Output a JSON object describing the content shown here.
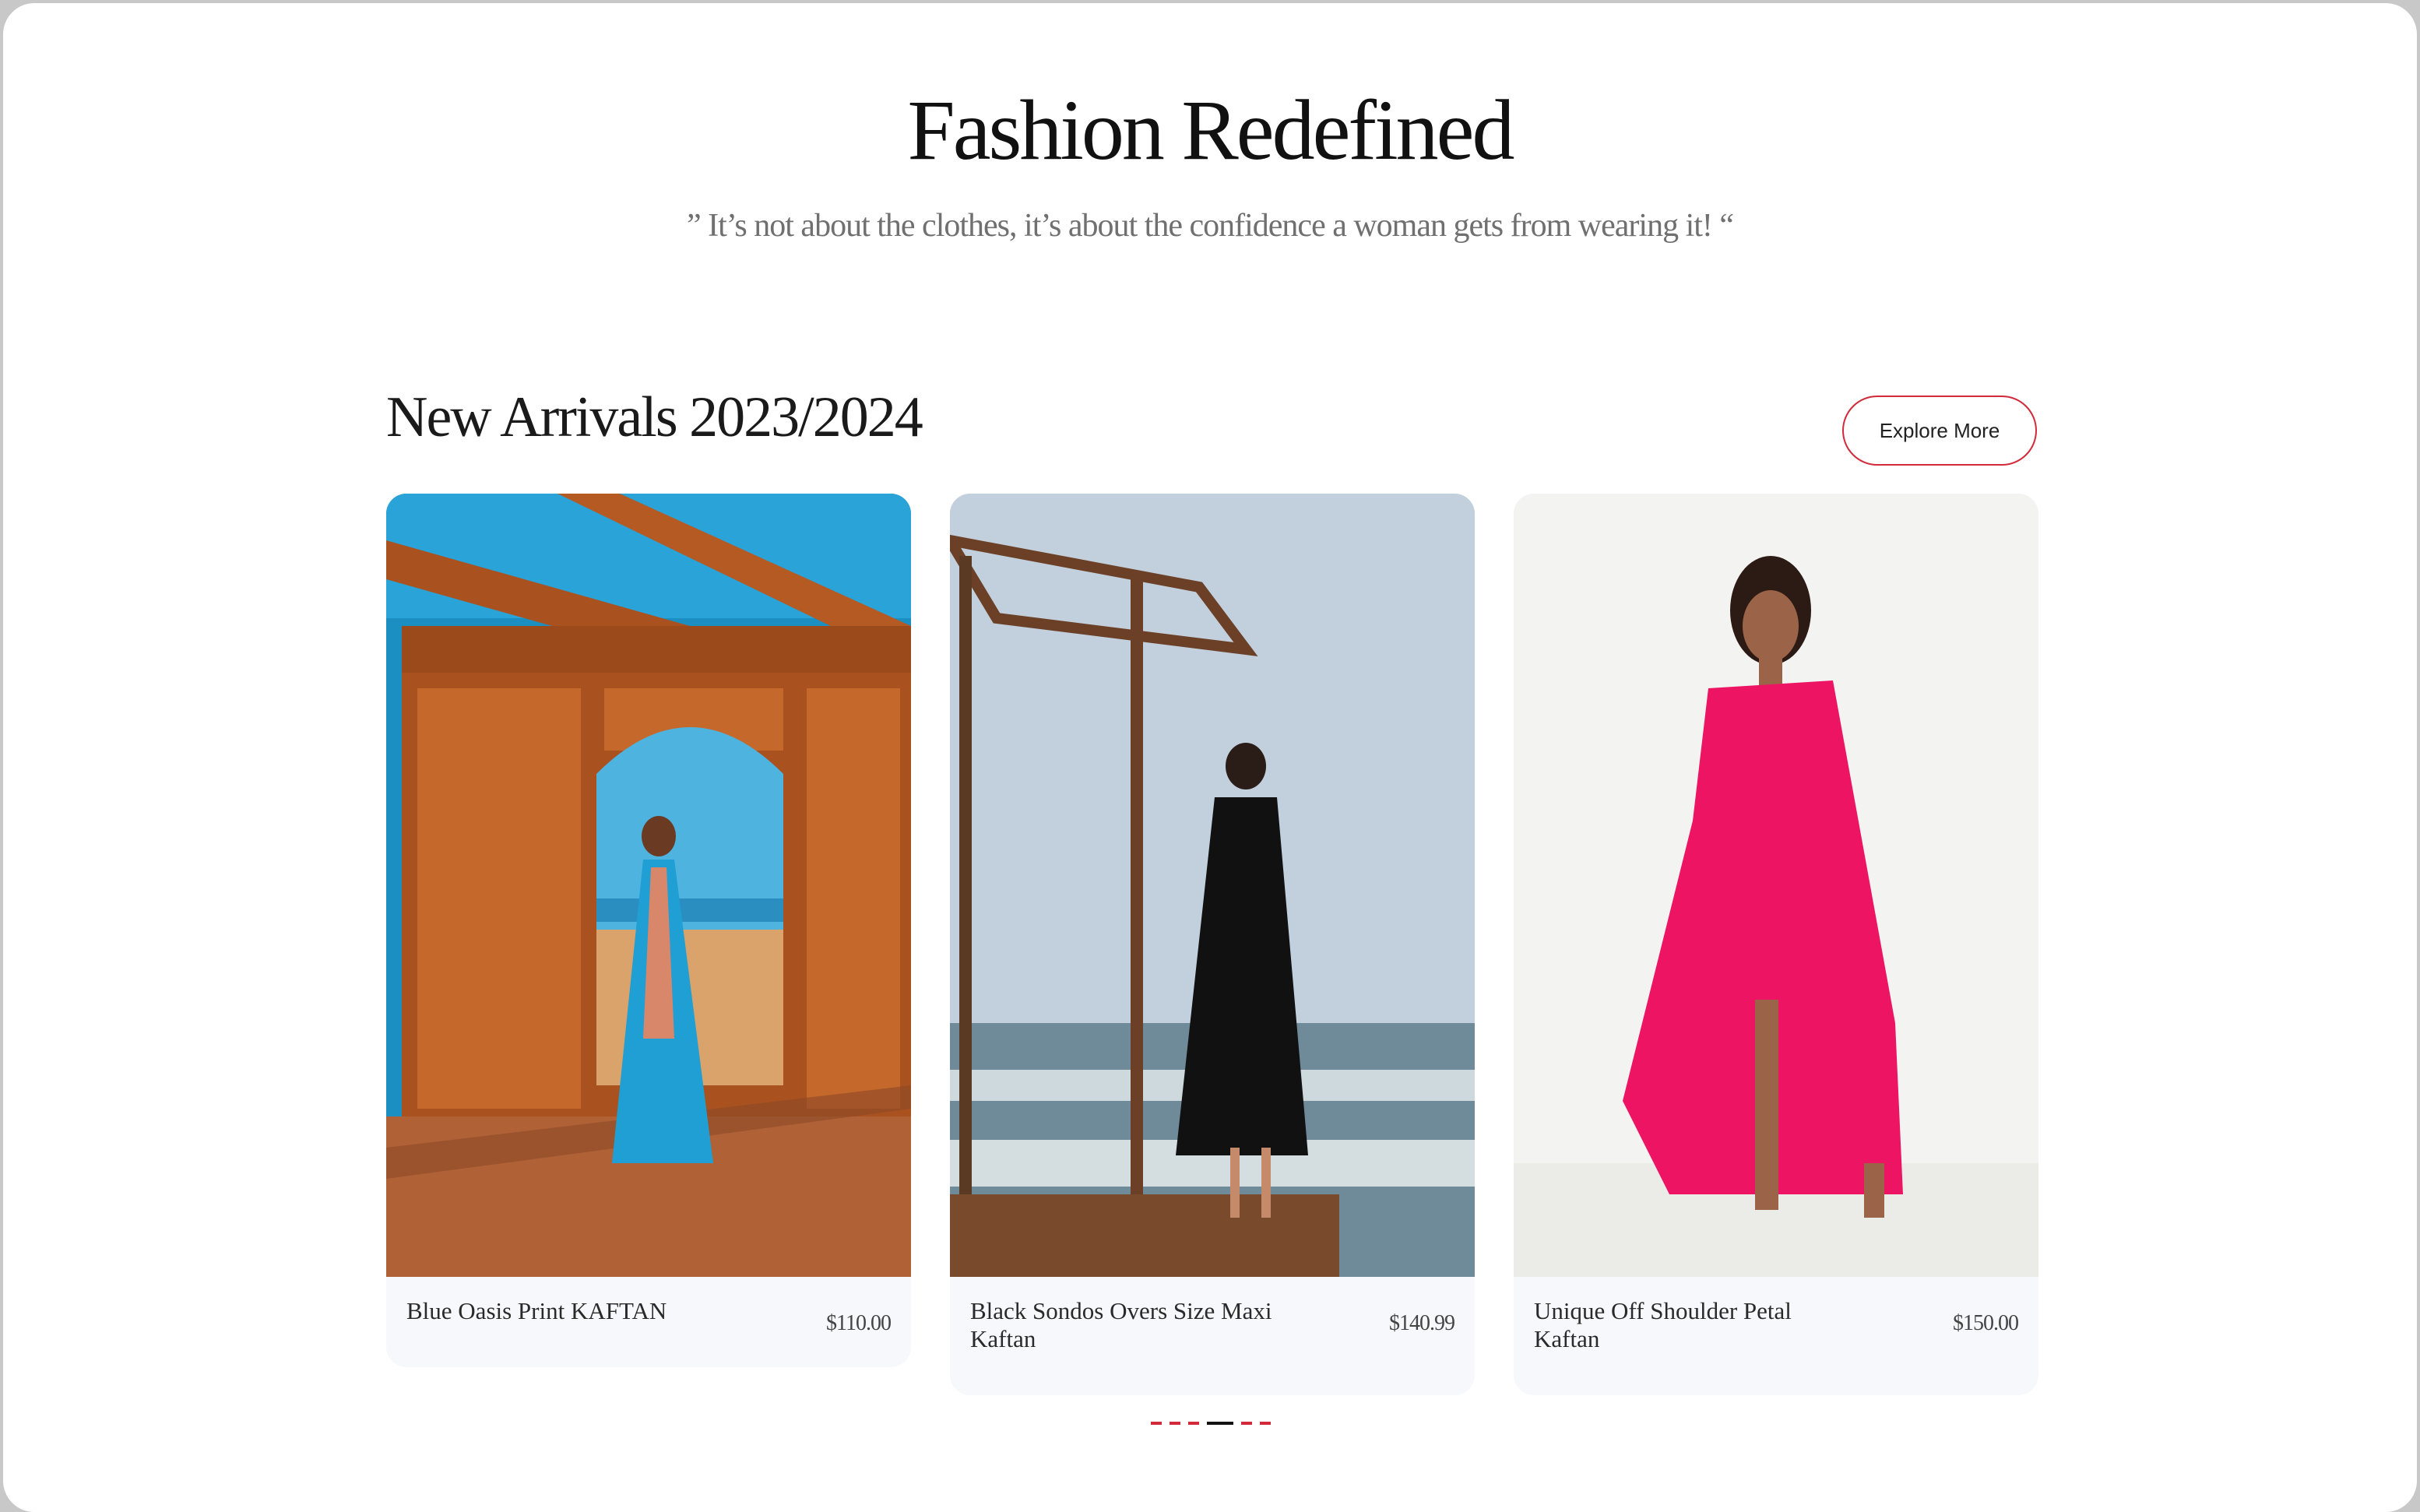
{
  "hero": {
    "title": "Fashion Redefined",
    "quote": "” It’s not about the clothes, it’s about the confidence a woman gets from wearing it! “"
  },
  "section": {
    "title": "New Arrivals 2023/2024",
    "explore_label": "Explore More"
  },
  "products": [
    {
      "name": "Blue Oasis Print KAFTAN",
      "price": "$110.00",
      "garment_color": "#1f9fd3"
    },
    {
      "name": "Black Sondos Overs Size Maxi Kaftan",
      "price": "$140.99",
      "garment_color": "#111111"
    },
    {
      "name": "Unique Off Shoulder Petal Kaftan",
      "price": "$150.00",
      "garment_color": "#ec1463"
    }
  ],
  "carousel": {
    "page_count": 5,
    "active_index": 3
  },
  "colors": {
    "accent": "#d22a3a",
    "card_bg": "#f7f8fb"
  }
}
